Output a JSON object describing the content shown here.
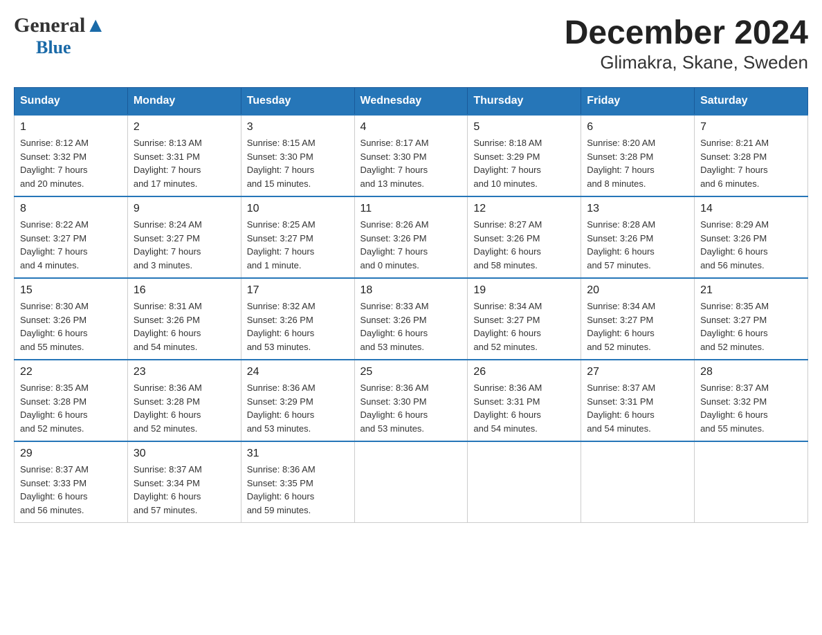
{
  "header": {
    "logo_general": "General",
    "logo_blue": "Blue",
    "title": "December 2024",
    "subtitle": "Glimakra, Skane, Sweden"
  },
  "days_of_week": [
    "Sunday",
    "Monday",
    "Tuesday",
    "Wednesday",
    "Thursday",
    "Friday",
    "Saturday"
  ],
  "weeks": [
    [
      {
        "day": "1",
        "sunrise": "8:12 AM",
        "sunset": "3:32 PM",
        "daylight": "7 hours and 20 minutes."
      },
      {
        "day": "2",
        "sunrise": "8:13 AM",
        "sunset": "3:31 PM",
        "daylight": "7 hours and 17 minutes."
      },
      {
        "day": "3",
        "sunrise": "8:15 AM",
        "sunset": "3:30 PM",
        "daylight": "7 hours and 15 minutes."
      },
      {
        "day": "4",
        "sunrise": "8:17 AM",
        "sunset": "3:30 PM",
        "daylight": "7 hours and 13 minutes."
      },
      {
        "day": "5",
        "sunrise": "8:18 AM",
        "sunset": "3:29 PM",
        "daylight": "7 hours and 10 minutes."
      },
      {
        "day": "6",
        "sunrise": "8:20 AM",
        "sunset": "3:28 PM",
        "daylight": "7 hours and 8 minutes."
      },
      {
        "day": "7",
        "sunrise": "8:21 AM",
        "sunset": "3:28 PM",
        "daylight": "7 hours and 6 minutes."
      }
    ],
    [
      {
        "day": "8",
        "sunrise": "8:22 AM",
        "sunset": "3:27 PM",
        "daylight": "7 hours and 4 minutes."
      },
      {
        "day": "9",
        "sunrise": "8:24 AM",
        "sunset": "3:27 PM",
        "daylight": "7 hours and 3 minutes."
      },
      {
        "day": "10",
        "sunrise": "8:25 AM",
        "sunset": "3:27 PM",
        "daylight": "7 hours and 1 minute."
      },
      {
        "day": "11",
        "sunrise": "8:26 AM",
        "sunset": "3:26 PM",
        "daylight": "7 hours and 0 minutes."
      },
      {
        "day": "12",
        "sunrise": "8:27 AM",
        "sunset": "3:26 PM",
        "daylight": "6 hours and 58 minutes."
      },
      {
        "day": "13",
        "sunrise": "8:28 AM",
        "sunset": "3:26 PM",
        "daylight": "6 hours and 57 minutes."
      },
      {
        "day": "14",
        "sunrise": "8:29 AM",
        "sunset": "3:26 PM",
        "daylight": "6 hours and 56 minutes."
      }
    ],
    [
      {
        "day": "15",
        "sunrise": "8:30 AM",
        "sunset": "3:26 PM",
        "daylight": "6 hours and 55 minutes."
      },
      {
        "day": "16",
        "sunrise": "8:31 AM",
        "sunset": "3:26 PM",
        "daylight": "6 hours and 54 minutes."
      },
      {
        "day": "17",
        "sunrise": "8:32 AM",
        "sunset": "3:26 PM",
        "daylight": "6 hours and 53 minutes."
      },
      {
        "day": "18",
        "sunrise": "8:33 AM",
        "sunset": "3:26 PM",
        "daylight": "6 hours and 53 minutes."
      },
      {
        "day": "19",
        "sunrise": "8:34 AM",
        "sunset": "3:27 PM",
        "daylight": "6 hours and 52 minutes."
      },
      {
        "day": "20",
        "sunrise": "8:34 AM",
        "sunset": "3:27 PM",
        "daylight": "6 hours and 52 minutes."
      },
      {
        "day": "21",
        "sunrise": "8:35 AM",
        "sunset": "3:27 PM",
        "daylight": "6 hours and 52 minutes."
      }
    ],
    [
      {
        "day": "22",
        "sunrise": "8:35 AM",
        "sunset": "3:28 PM",
        "daylight": "6 hours and 52 minutes."
      },
      {
        "day": "23",
        "sunrise": "8:36 AM",
        "sunset": "3:28 PM",
        "daylight": "6 hours and 52 minutes."
      },
      {
        "day": "24",
        "sunrise": "8:36 AM",
        "sunset": "3:29 PM",
        "daylight": "6 hours and 53 minutes."
      },
      {
        "day": "25",
        "sunrise": "8:36 AM",
        "sunset": "3:30 PM",
        "daylight": "6 hours and 53 minutes."
      },
      {
        "day": "26",
        "sunrise": "8:36 AM",
        "sunset": "3:31 PM",
        "daylight": "6 hours and 54 minutes."
      },
      {
        "day": "27",
        "sunrise": "8:37 AM",
        "sunset": "3:31 PM",
        "daylight": "6 hours and 54 minutes."
      },
      {
        "day": "28",
        "sunrise": "8:37 AM",
        "sunset": "3:32 PM",
        "daylight": "6 hours and 55 minutes."
      }
    ],
    [
      {
        "day": "29",
        "sunrise": "8:37 AM",
        "sunset": "3:33 PM",
        "daylight": "6 hours and 56 minutes."
      },
      {
        "day": "30",
        "sunrise": "8:37 AM",
        "sunset": "3:34 PM",
        "daylight": "6 hours and 57 minutes."
      },
      {
        "day": "31",
        "sunrise": "8:36 AM",
        "sunset": "3:35 PM",
        "daylight": "6 hours and 59 minutes."
      },
      null,
      null,
      null,
      null
    ]
  ],
  "labels": {
    "sunrise": "Sunrise: ",
    "sunset": "Sunset: ",
    "daylight": "Daylight: "
  }
}
